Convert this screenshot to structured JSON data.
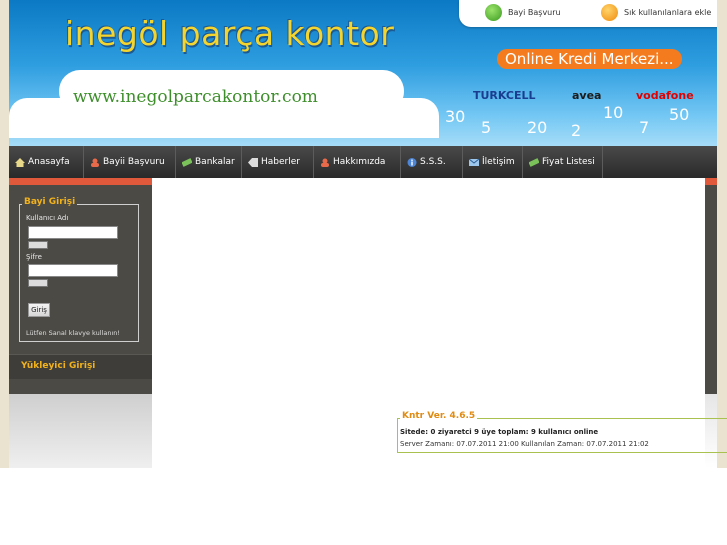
{
  "header": {
    "title": "inegöl parça kontor",
    "url": "www.inegolparcakontor.com",
    "badge": "Online Kredi Merkezi...",
    "operators": [
      "TURKCELL",
      "avea",
      "vodafone"
    ],
    "numbers": [
      "30",
      "5",
      "20",
      "2",
      "10",
      "7",
      "50"
    ]
  },
  "top_links": {
    "bayi": "Bayi Başvuru",
    "favorites": "Sık kullanılanlara ekle"
  },
  "nav": {
    "items": [
      "Anasayfa",
      "Bayii Başvuru",
      "Bankalar",
      "Haberler",
      "Hakkımızda",
      "S.S.S.",
      "İletişim",
      "Fiyat Listesi"
    ]
  },
  "login": {
    "legend": "Bayi Girişi",
    "username_label": "Kullanıcı Adı",
    "password_label": "Şifre",
    "submit": "Giriş",
    "note": "Lütfen Sanal klavye kullanın!"
  },
  "uploader": {
    "label": "Yükleyici Girişi"
  },
  "footer": {
    "legend": "Kntr Ver. 4.6.5",
    "line1": "Sitede: 0 ziyaretci 9 üye toplam: 9 kullanıcı online",
    "line2": "Server Zamanı: 07.07.2011 21:00 Kullanılan Zaman: 07.07.2011 21:02"
  },
  "colors": {
    "brand_yellow": "#f4d530",
    "accent_orange": "#f57c1e",
    "nav_bg": "#2a2a2a",
    "sidebar_bg": "#4c4a45",
    "legend_gold": "#f2b21b"
  }
}
